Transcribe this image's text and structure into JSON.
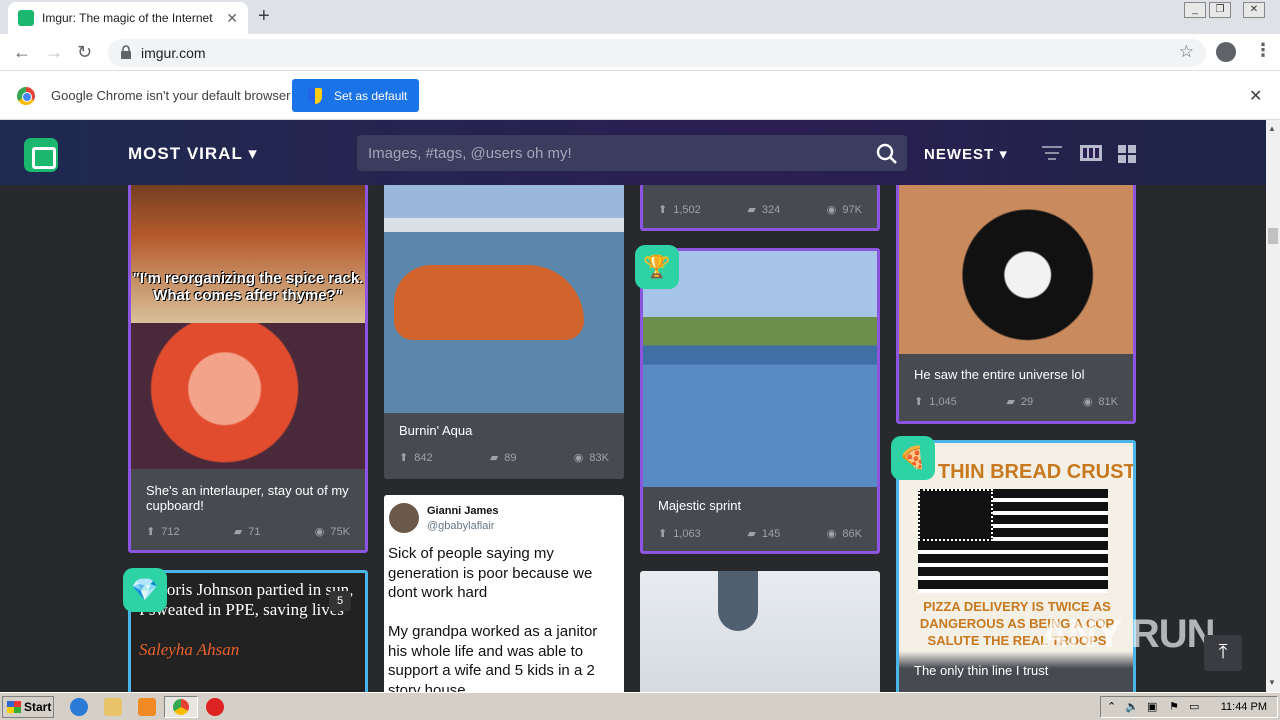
{
  "browser": {
    "tab_title": "Imgur: The magic of the Internet",
    "tab_close": "✕",
    "new_tab": "+",
    "url": "imgur.com",
    "back": "←",
    "forward": "→",
    "reload": "↻",
    "bookmark": "☆",
    "menu": "⋮"
  },
  "infobar": {
    "message": "Google Chrome isn't your default browser",
    "set_default": "Set as default",
    "close": "✕"
  },
  "imgur": {
    "section": "MOST VIRAL",
    "search_placeholder": "Images, #tags, @users oh my!",
    "sort": "NEWEST",
    "caret": "▾"
  },
  "cards": [
    {
      "title": "She's an interlauper, stay out of my cupboard!",
      "ups": "712",
      "comments": "71",
      "views": "75K",
      "caption": "\"I'm reorganizing the spice rack. What comes after thyme?\""
    },
    {
      "title": "Burnin' Aqua",
      "ups": "842",
      "comments": "89",
      "views": "83K"
    },
    {
      "title": "",
      "ups": "1,502",
      "comments": "324",
      "views": "97K"
    },
    {
      "title": "Majestic sprint",
      "ups": "1,063",
      "comments": "145",
      "views": "86K"
    },
    {
      "title": "He saw the entire universe lol",
      "ups": "1,045",
      "comments": "29",
      "views": "81K"
    },
    {
      "title": "The only thin line I trust",
      "top_text": "E THIN BREAD CRUST",
      "bottom_text": "PIZZA DELIVERY IS TWICE AS DANGEROUS AS BEING A COP SALUTE THE REAL TROOPS"
    }
  ],
  "tweet": {
    "name": "Gianni James",
    "handle": "@gbabylaflair",
    "body": "Sick of people saying my generation is poor because we dont work hard\n\nMy grandpa worked as a janitor his whole life and was able to support a wife and 5 kids in a 2 story house"
  },
  "quote_card": {
    "text": "le Boris Johnson partied in sun, I sweated in PPE, saving lives",
    "author": "Saleyha Ahsan",
    "count": "5"
  },
  "taskbar": {
    "start": "Start",
    "clock": "11:44 PM"
  },
  "watermark": "ANY RUN",
  "to_top": "⤒"
}
